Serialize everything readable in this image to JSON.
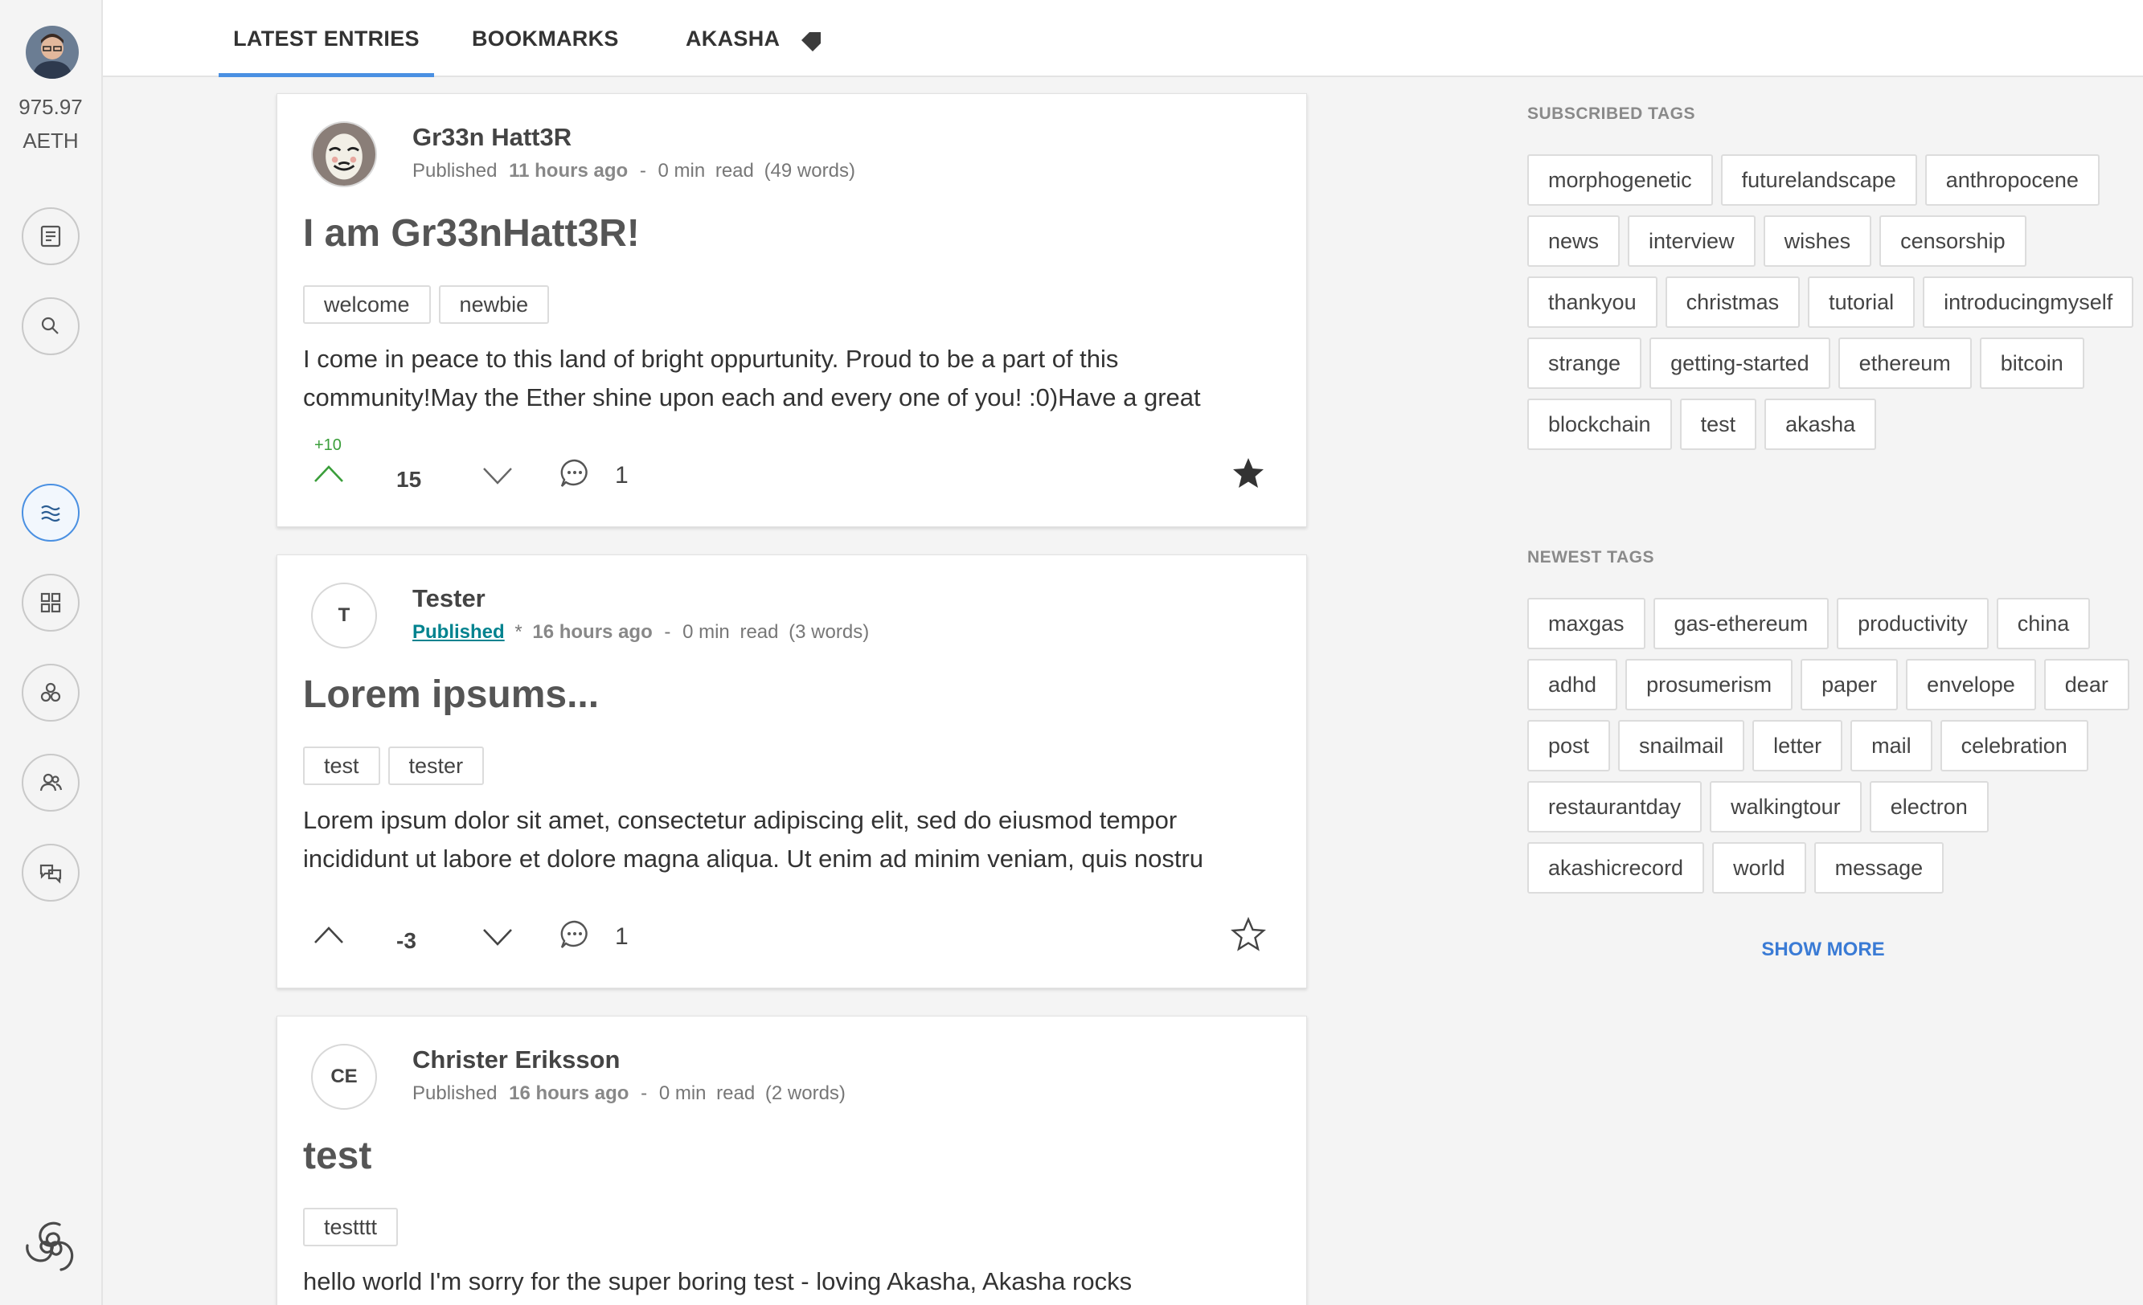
{
  "wallet": {
    "balance": "975.97",
    "unit": "AETH"
  },
  "tabs": [
    {
      "label": "LATEST ENTRIES"
    },
    {
      "label": "BOOKMARKS"
    },
    {
      "label": "AKASHA"
    }
  ],
  "icons": {
    "rail": [
      "new-entry-icon",
      "search-icon",
      "stream-icon",
      "dashboard-icon",
      "communities-icon",
      "people-icon",
      "chat-icon"
    ],
    "logo": "akasha-triskelion-icon"
  },
  "colors": {
    "accent": "#4a90e2",
    "upvote": "#3a9e3a",
    "published_link": "#00838f"
  },
  "entries": [
    {
      "author": "Gr33n Hatt3R",
      "avatar_initials": "",
      "status": "Published",
      "status_is_link": false,
      "draft_mark": "",
      "time": "11 hours ago",
      "separator": "-",
      "read_time": "0 min",
      "read_label": "read",
      "words": "(49 words)",
      "title": "I am Gr33nHatt3R!",
      "tags": [
        "welcome",
        "newbie"
      ],
      "excerpt": "I come in peace to this land of bright oppurtunity. Proud to be a part of this community!May the Ether shine upon each and every one of you! :0)Have a great",
      "vote_delta": "+10",
      "score": "15",
      "comments": "1",
      "bookmarked": true
    },
    {
      "author": "Tester",
      "avatar_initials": "T",
      "status": "Published",
      "status_is_link": true,
      "draft_mark": "*",
      "time": "16 hours ago",
      "separator": "-",
      "read_time": "0 min",
      "read_label": "read",
      "words": "(3 words)",
      "title": "Lorem ipsums...",
      "tags": [
        "test",
        "tester"
      ],
      "excerpt": "Lorem ipsum dolor sit amet, consectetur adipiscing elit, sed do eiusmod tempor incididunt ut labore et dolore magna aliqua. Ut enim ad minim veniam, quis nostru",
      "vote_delta": "",
      "score": "-3",
      "comments": "1",
      "bookmarked": false
    },
    {
      "author": "Christer Eriksson",
      "avatar_initials": "CE",
      "status": "Published",
      "status_is_link": false,
      "draft_mark": "",
      "time": "16 hours ago",
      "separator": "-",
      "read_time": "0 min",
      "read_label": "read",
      "words": "(2 words)",
      "title": "test",
      "tags": [
        "testttt"
      ],
      "excerpt": "hello world I'm sorry for the super boring test - loving Akasha, Akasha rocks",
      "vote_delta": "",
      "score": "",
      "comments": "",
      "bookmarked": false
    }
  ],
  "sidebar": {
    "subscribed_title": "SUBSCRIBED TAGS",
    "subscribed_tags": [
      "morphogenetic",
      "futurelandscape",
      "anthropocene",
      "news",
      "interview",
      "wishes",
      "censorship",
      "thankyou",
      "christmas",
      "tutorial",
      "introducingmyself",
      "strange",
      "getting-started",
      "ethereum",
      "bitcoin",
      "blockchain",
      "test",
      "akasha"
    ],
    "newest_title": "NEWEST TAGS",
    "newest_tags": [
      "maxgas",
      "gas-ethereum",
      "productivity",
      "china",
      "adhd",
      "prosumerism",
      "paper",
      "envelope",
      "dear",
      "post",
      "snailmail",
      "letter",
      "mail",
      "celebration",
      "restaurantday",
      "walkingtour",
      "electron",
      "akashicrecord",
      "world",
      "message"
    ],
    "show_more": "SHOW MORE"
  }
}
